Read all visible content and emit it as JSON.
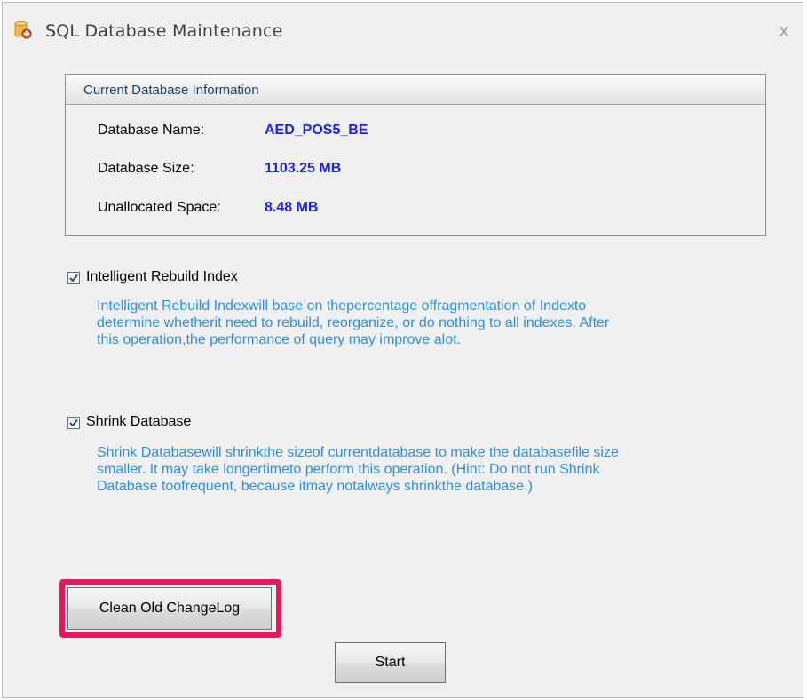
{
  "window": {
    "title": "SQL Database Maintenance",
    "close_glyph": "x"
  },
  "db_info": {
    "title": "Current Database Information",
    "rows": [
      {
        "label": "Database Name:",
        "value": "AED_POS5_BE"
      },
      {
        "label": "Database Size:",
        "value": "1103.25 MB"
      },
      {
        "label": "Unallocated Space:",
        "value": "8.48 MB"
      }
    ]
  },
  "options": [
    {
      "label": "Intelligent Rebuild Index",
      "checked": true,
      "description": [
        "Intelligent Rebuild Indexwill base on thepercentage offragmentation of Indexto",
        "determine whetherit need to rebuild, reorganize, or do nothing to all indexes. After",
        "this operation,the performance of query may improve alot."
      ]
    },
    {
      "label": "Shrink Database",
      "checked": true,
      "description": [
        "Shrink Databasewill shrinkthe sizeof currentdatabase to make the databasefile size",
        "smaller. It may take longertimeto perform this operation. (Hint: Do not run Shrink",
        "Database toofrequent, because itmay notalways shrinkthe database.)"
      ]
    }
  ],
  "buttons": {
    "clean_changelog": "Clean Old ChangeLog",
    "start": "Start"
  },
  "colors": {
    "value_text": "#1e1ef0",
    "description_text": "#2e8fe0",
    "highlight_border": "#e8175d"
  },
  "icons": {
    "app": "database-maintenance-icon",
    "close": "close-icon",
    "checkbox": "checkmark-icon"
  }
}
